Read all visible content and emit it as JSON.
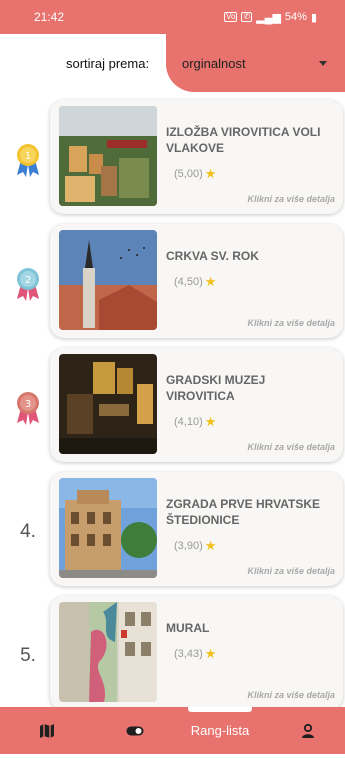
{
  "status_bar": {
    "time": "21:42",
    "network": "VoLTE",
    "battery": "54%"
  },
  "sort": {
    "label": "sortiraj prema:",
    "value": "orginalnost"
  },
  "items": [
    {
      "rank": "",
      "medal": "gold",
      "medal_number": "1",
      "title": "IZLOŽBA VIROVITICA VOLI VLAKOVE",
      "rating": "(5,00)",
      "details": "Klikni za više detalja"
    },
    {
      "rank": "",
      "medal": "silver",
      "medal_number": "2",
      "title": "CRKVA SV. ROK",
      "rating": "(4,50)",
      "details": "Klikni za više detalja"
    },
    {
      "rank": "",
      "medal": "bronze",
      "medal_number": "3",
      "title": "GRADSKI MUZEJ VIROVITICA",
      "rating": "(4,10)",
      "details": "Klikni za više detalja"
    },
    {
      "rank": "4.",
      "medal": "",
      "medal_number": "",
      "title": "ZGRADA PRVE HRVATSKE ŠTEDIONICE",
      "rating": "(3,90)",
      "details": "Klikni za više detalja"
    },
    {
      "rank": "5.",
      "medal": "",
      "medal_number": "",
      "title": "MURAL",
      "rating": "(3,43)",
      "details": "Klikni za više detalja"
    }
  ],
  "bottom_nav": {
    "items": [
      {
        "icon": "map-icon"
      },
      {
        "icon": "toggle-icon"
      },
      {
        "label": "Rang-lista"
      },
      {
        "icon": "person-icon"
      }
    ]
  },
  "colors": {
    "accent": "#e8736e",
    "card": "#f8f7f5",
    "star": "#f2c11c"
  }
}
